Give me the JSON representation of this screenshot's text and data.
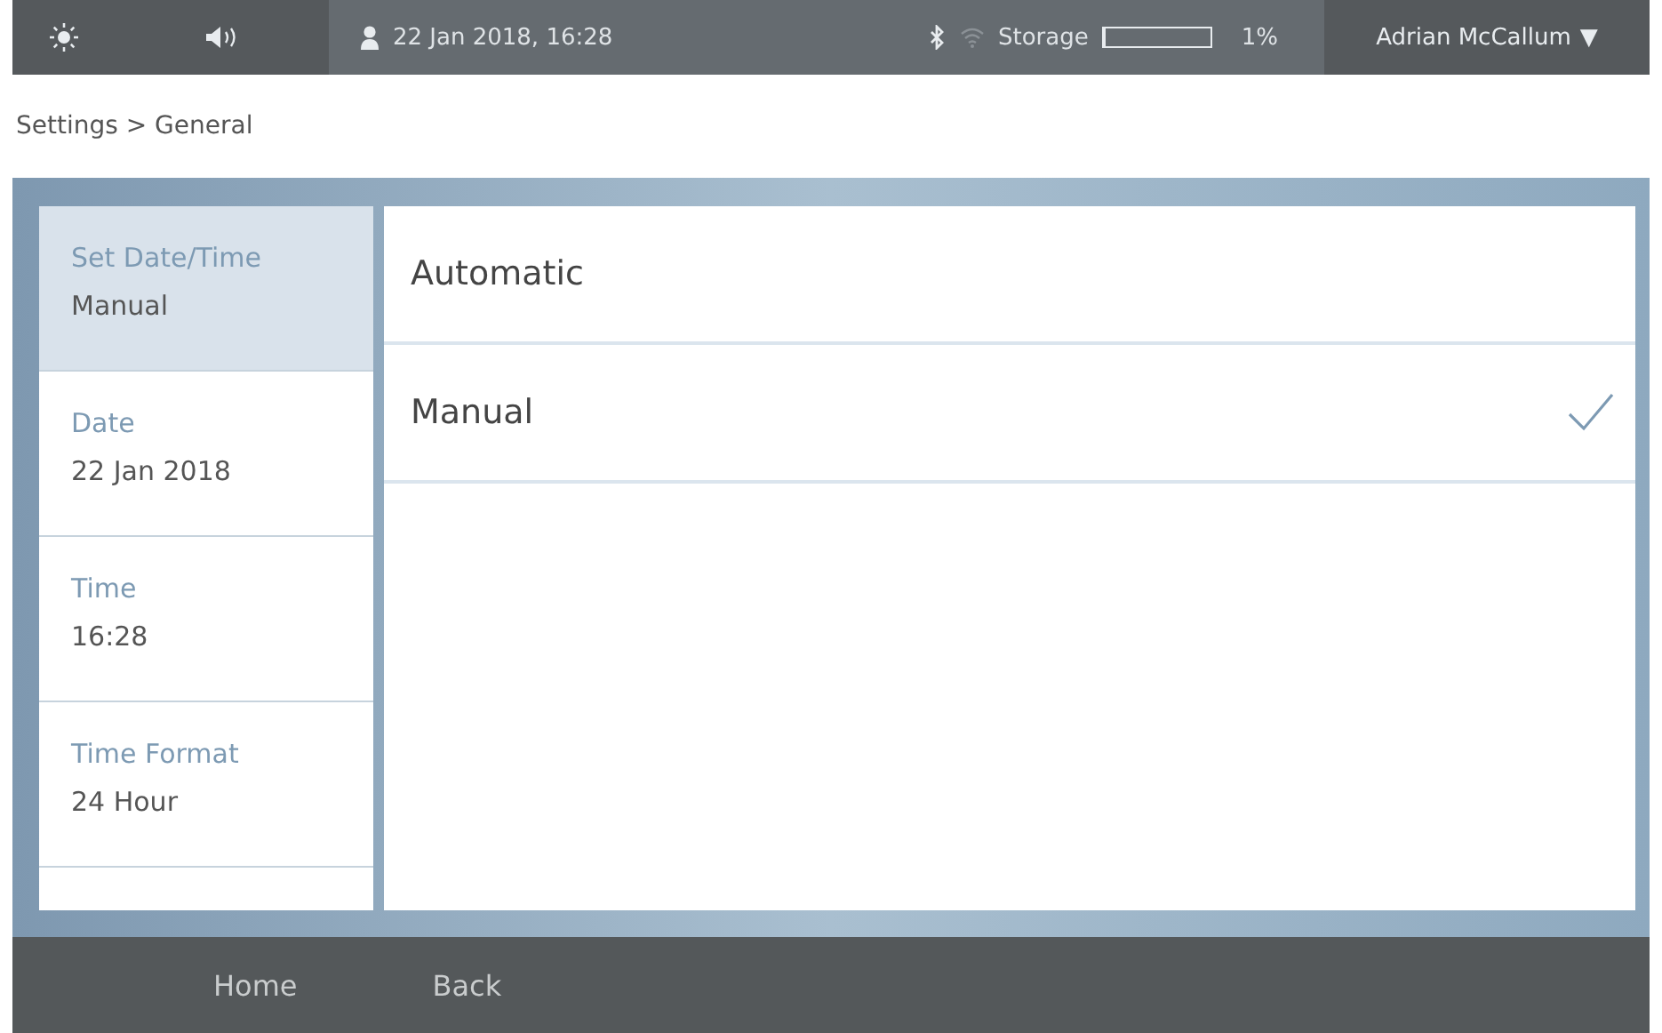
{
  "status_bar": {
    "datetime": "22 Jan 2018, 16:28",
    "storage_label": "Storage",
    "storage": {
      "level": 0.01
    },
    "storage_reading": "1%",
    "user": "Adrian McCallum",
    "user_caret": "▼"
  },
  "breadcrumb": "Settings > General",
  "sidebar": {
    "items": [
      {
        "label": "Set Date/Time",
        "value": "Manual",
        "selected": true
      },
      {
        "label": "Date",
        "value": "22 Jan 2018",
        "selected": false
      },
      {
        "label": "Time",
        "value": "16:28",
        "selected": false
      },
      {
        "label": "Time Format",
        "value": "24 Hour",
        "selected": false
      }
    ]
  },
  "options": [
    {
      "label": "Automatic",
      "selected": false
    },
    {
      "label": "Manual",
      "selected": true
    }
  ],
  "footer": {
    "buttons": [
      "Home",
      "Back"
    ]
  }
}
